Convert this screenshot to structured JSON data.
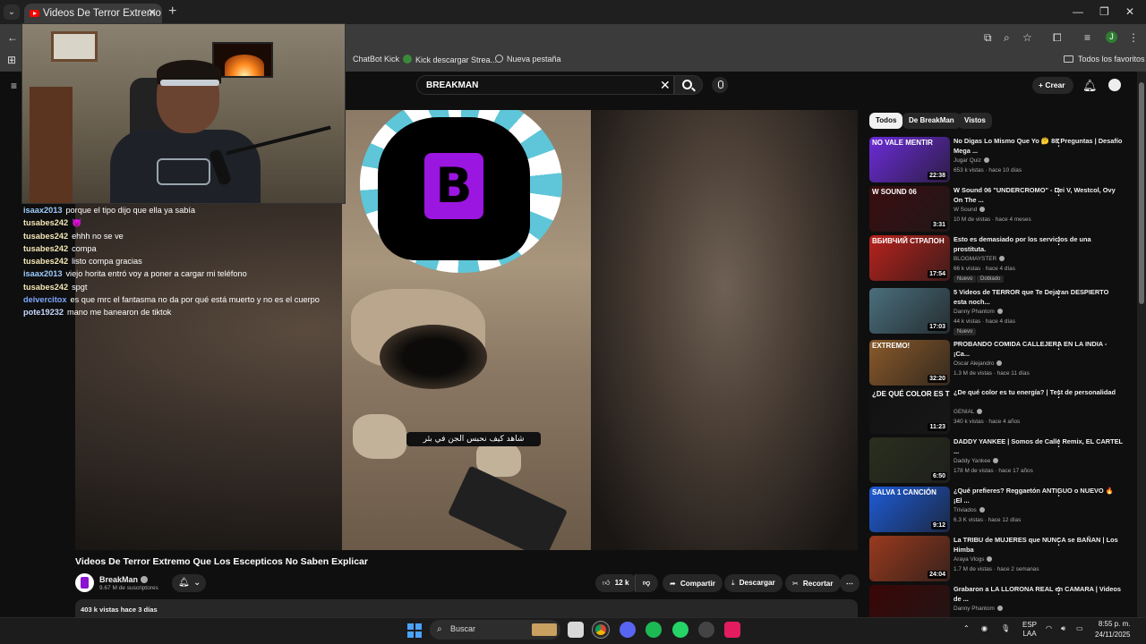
{
  "browser": {
    "tab_title": "Videos De Terror Extremo Que Lo",
    "bookmarks": [
      {
        "label": "ChatBot Kick"
      },
      {
        "label": "Kick descargar Strea..."
      },
      {
        "label": "Nueva pestaña"
      }
    ],
    "favorites_label": "Todos los favoritos",
    "profile_initial": "J"
  },
  "youtube": {
    "search_value": "BREAKMAN",
    "create_label": "Crear"
  },
  "chat": [
    {
      "user": "isaax2013",
      "color": "#9ecbff",
      "text": "porque el tipo dijo que ella ya sabía"
    },
    {
      "user": "tusabes242",
      "color": "#f5e6b5",
      "text": "😈"
    },
    {
      "user": "tusabes242",
      "color": "#f5e6b5",
      "text": "ehhh no se ve"
    },
    {
      "user": "tusabes242",
      "color": "#f5e6b5",
      "text": "compa"
    },
    {
      "user": "tusabes242",
      "color": "#f5e6b5",
      "text": "listo compa gracias"
    },
    {
      "user": "isaax2013",
      "color": "#9ecbff",
      "text": "viejo horita entró voy a poner a cargar mi teléfono"
    },
    {
      "user": "tusabes242",
      "color": "#f5e6b5",
      "text": "spgt"
    },
    {
      "user": "deivercitox",
      "color": "#7fa8ff",
      "text": "es que mrc el fantasma no da por qué está muerto y no es el cuerpo"
    },
    {
      "user": "pote19232",
      "color": "#c6d9ff",
      "text": "mano me banearon de tiktok"
    }
  ],
  "video": {
    "caption": "شاهد كيف نحبس الجن في بئر",
    "title": "Videos De Terror Extremo Que Los Escepticos No Saben Explicar",
    "channel": "BreakMan",
    "subscribers": "9.67 M de suscriptores",
    "likes": "12 k",
    "share_label": "Compartir",
    "download_label": "Descargar",
    "clip_label": "Recortar",
    "views": "403 k vistas",
    "date": "hace 3 días"
  },
  "chips": [
    "Todos",
    "De BreakMan",
    "Vistos"
  ],
  "recommendations": [
    {
      "title": "No Digas Lo Mismo Que Yo 🤔 88 Preguntas | Desafío Mega ...",
      "channel": "Jugar Quiz",
      "meta": "653 k vistas · hace 10 días",
      "duration": "22:38",
      "thumb_text": "NO VALE MENTIR",
      "thumb_color": "#6c2bd9",
      "badges": []
    },
    {
      "title": "W Sound 06 \"UNDERCROMO\" - Dei V, Westcol, Ovy On The ...",
      "channel": "W Sound",
      "meta": "10 M de vistas · hace 4 meses",
      "duration": "3:31",
      "thumb_text": "W SOUND 06",
      "thumb_color": "#3a0d10",
      "badges": []
    },
    {
      "title": "Esto es demasiado por los servicios de una prostituta.",
      "channel": "BLOGMAYSTER",
      "meta": "66 k vistas · hace 4 días",
      "duration": "17:54",
      "thumb_text": "ВБИВЧИЙ СТРАПОН",
      "thumb_color": "#b8221c",
      "badges": [
        "Nuevo",
        "Doblado"
      ]
    },
    {
      "title": "5 Videos de TERROR que Te Dejaran DESPIERTO esta noch...",
      "channel": "Danny Phantom",
      "meta": "44 k vistas · hace 4 días",
      "duration": "17:03",
      "thumb_text": "",
      "thumb_color": "#4a6f7d",
      "badges": [
        "Nuevo"
      ]
    },
    {
      "title": "PROBANDO COMIDA CALLEJERA EN LA INDIA - ¡Ca...",
      "channel": "Oscar Alejandro",
      "meta": "1.3 M de vistas · hace 11 días",
      "duration": "32:20",
      "thumb_text": "EXTREMO!",
      "thumb_color": "#8a5a2a",
      "badges": []
    },
    {
      "title": "¿De qué color es tu energía? | Test de personalidad",
      "channel": "GENIAL",
      "meta": "340 k vistas · hace 4 años",
      "duration": "11:23",
      "thumb_text": "¿DE QUÉ COLOR ES TU ENERGÍA?",
      "thumb_color": "#111111",
      "badges": []
    },
    {
      "title": "DADDY YANKEE | Somos de Calle Remix, EL CARTEL ...",
      "channel": "Daddy Yankee",
      "meta": "178 M de vistas · hace 17 años",
      "duration": "6:50",
      "thumb_text": "",
      "thumb_color": "#2a2f1e",
      "badges": []
    },
    {
      "title": "¿Qué prefieres? Reggaetón ANTIGUO o NUEVO 🔥 ¡El ...",
      "channel": "Triviados",
      "meta": "6.3 K vistas · hace 12 días",
      "duration": "9:12",
      "thumb_text": "SALVA 1 CANCIÓN",
      "thumb_color": "#1e5bd6",
      "badges": []
    },
    {
      "title": "La TRIBU de MUJERES que NUNCA se BAÑAN | Los Himba",
      "channel": "Araya Vlogs",
      "meta": "1.7 M de vistas · hace 2 semanas",
      "duration": "24:04",
      "thumb_text": "",
      "thumb_color": "#9a3a1e",
      "badges": []
    },
    {
      "title": "Grabaron a LA LLORONA REAL en CAMARA | Videos de ...",
      "channel": "Danny Phantom",
      "meta": "",
      "duration": "",
      "thumb_text": "",
      "thumb_color": "#3a0606",
      "badges": []
    }
  ],
  "taskbar": {
    "search_label": "Buscar",
    "lang_top": "ESP",
    "lang_bottom": "LAA",
    "time": "8:55 p. m.",
    "date": "24/11/2025"
  }
}
